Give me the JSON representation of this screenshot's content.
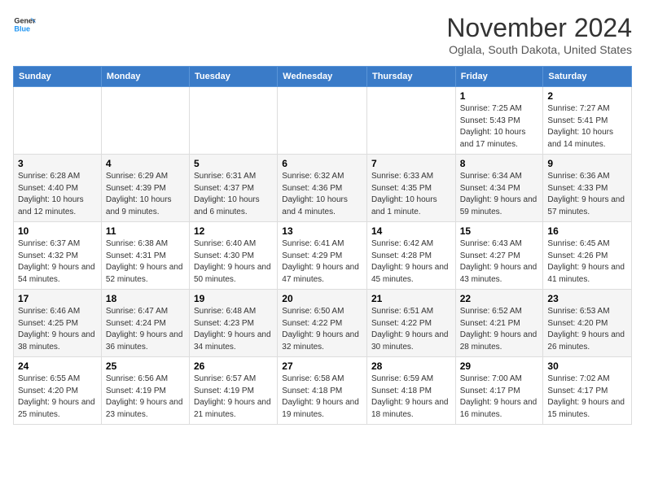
{
  "header": {
    "logo_line1": "General",
    "logo_line2": "Blue",
    "month": "November 2024",
    "location": "Oglala, South Dakota, United States"
  },
  "weekdays": [
    "Sunday",
    "Monday",
    "Tuesday",
    "Wednesday",
    "Thursday",
    "Friday",
    "Saturday"
  ],
  "weeks": [
    [
      {
        "day": "",
        "info": ""
      },
      {
        "day": "",
        "info": ""
      },
      {
        "day": "",
        "info": ""
      },
      {
        "day": "",
        "info": ""
      },
      {
        "day": "",
        "info": ""
      },
      {
        "day": "1",
        "info": "Sunrise: 7:25 AM\nSunset: 5:43 PM\nDaylight: 10 hours and 17 minutes."
      },
      {
        "day": "2",
        "info": "Sunrise: 7:27 AM\nSunset: 5:41 PM\nDaylight: 10 hours and 14 minutes."
      }
    ],
    [
      {
        "day": "3",
        "info": "Sunrise: 6:28 AM\nSunset: 4:40 PM\nDaylight: 10 hours and 12 minutes."
      },
      {
        "day": "4",
        "info": "Sunrise: 6:29 AM\nSunset: 4:39 PM\nDaylight: 10 hours and 9 minutes."
      },
      {
        "day": "5",
        "info": "Sunrise: 6:31 AM\nSunset: 4:37 PM\nDaylight: 10 hours and 6 minutes."
      },
      {
        "day": "6",
        "info": "Sunrise: 6:32 AM\nSunset: 4:36 PM\nDaylight: 10 hours and 4 minutes."
      },
      {
        "day": "7",
        "info": "Sunrise: 6:33 AM\nSunset: 4:35 PM\nDaylight: 10 hours and 1 minute."
      },
      {
        "day": "8",
        "info": "Sunrise: 6:34 AM\nSunset: 4:34 PM\nDaylight: 9 hours and 59 minutes."
      },
      {
        "day": "9",
        "info": "Sunrise: 6:36 AM\nSunset: 4:33 PM\nDaylight: 9 hours and 57 minutes."
      }
    ],
    [
      {
        "day": "10",
        "info": "Sunrise: 6:37 AM\nSunset: 4:32 PM\nDaylight: 9 hours and 54 minutes."
      },
      {
        "day": "11",
        "info": "Sunrise: 6:38 AM\nSunset: 4:31 PM\nDaylight: 9 hours and 52 minutes."
      },
      {
        "day": "12",
        "info": "Sunrise: 6:40 AM\nSunset: 4:30 PM\nDaylight: 9 hours and 50 minutes."
      },
      {
        "day": "13",
        "info": "Sunrise: 6:41 AM\nSunset: 4:29 PM\nDaylight: 9 hours and 47 minutes."
      },
      {
        "day": "14",
        "info": "Sunrise: 6:42 AM\nSunset: 4:28 PM\nDaylight: 9 hours and 45 minutes."
      },
      {
        "day": "15",
        "info": "Sunrise: 6:43 AM\nSunset: 4:27 PM\nDaylight: 9 hours and 43 minutes."
      },
      {
        "day": "16",
        "info": "Sunrise: 6:45 AM\nSunset: 4:26 PM\nDaylight: 9 hours and 41 minutes."
      }
    ],
    [
      {
        "day": "17",
        "info": "Sunrise: 6:46 AM\nSunset: 4:25 PM\nDaylight: 9 hours and 38 minutes."
      },
      {
        "day": "18",
        "info": "Sunrise: 6:47 AM\nSunset: 4:24 PM\nDaylight: 9 hours and 36 minutes."
      },
      {
        "day": "19",
        "info": "Sunrise: 6:48 AM\nSunset: 4:23 PM\nDaylight: 9 hours and 34 minutes."
      },
      {
        "day": "20",
        "info": "Sunrise: 6:50 AM\nSunset: 4:22 PM\nDaylight: 9 hours and 32 minutes."
      },
      {
        "day": "21",
        "info": "Sunrise: 6:51 AM\nSunset: 4:22 PM\nDaylight: 9 hours and 30 minutes."
      },
      {
        "day": "22",
        "info": "Sunrise: 6:52 AM\nSunset: 4:21 PM\nDaylight: 9 hours and 28 minutes."
      },
      {
        "day": "23",
        "info": "Sunrise: 6:53 AM\nSunset: 4:20 PM\nDaylight: 9 hours and 26 minutes."
      }
    ],
    [
      {
        "day": "24",
        "info": "Sunrise: 6:55 AM\nSunset: 4:20 PM\nDaylight: 9 hours and 25 minutes."
      },
      {
        "day": "25",
        "info": "Sunrise: 6:56 AM\nSunset: 4:19 PM\nDaylight: 9 hours and 23 minutes."
      },
      {
        "day": "26",
        "info": "Sunrise: 6:57 AM\nSunset: 4:19 PM\nDaylight: 9 hours and 21 minutes."
      },
      {
        "day": "27",
        "info": "Sunrise: 6:58 AM\nSunset: 4:18 PM\nDaylight: 9 hours and 19 minutes."
      },
      {
        "day": "28",
        "info": "Sunrise: 6:59 AM\nSunset: 4:18 PM\nDaylight: 9 hours and 18 minutes."
      },
      {
        "day": "29",
        "info": "Sunrise: 7:00 AM\nSunset: 4:17 PM\nDaylight: 9 hours and 16 minutes."
      },
      {
        "day": "30",
        "info": "Sunrise: 7:02 AM\nSunset: 4:17 PM\nDaylight: 9 hours and 15 minutes."
      }
    ]
  ]
}
